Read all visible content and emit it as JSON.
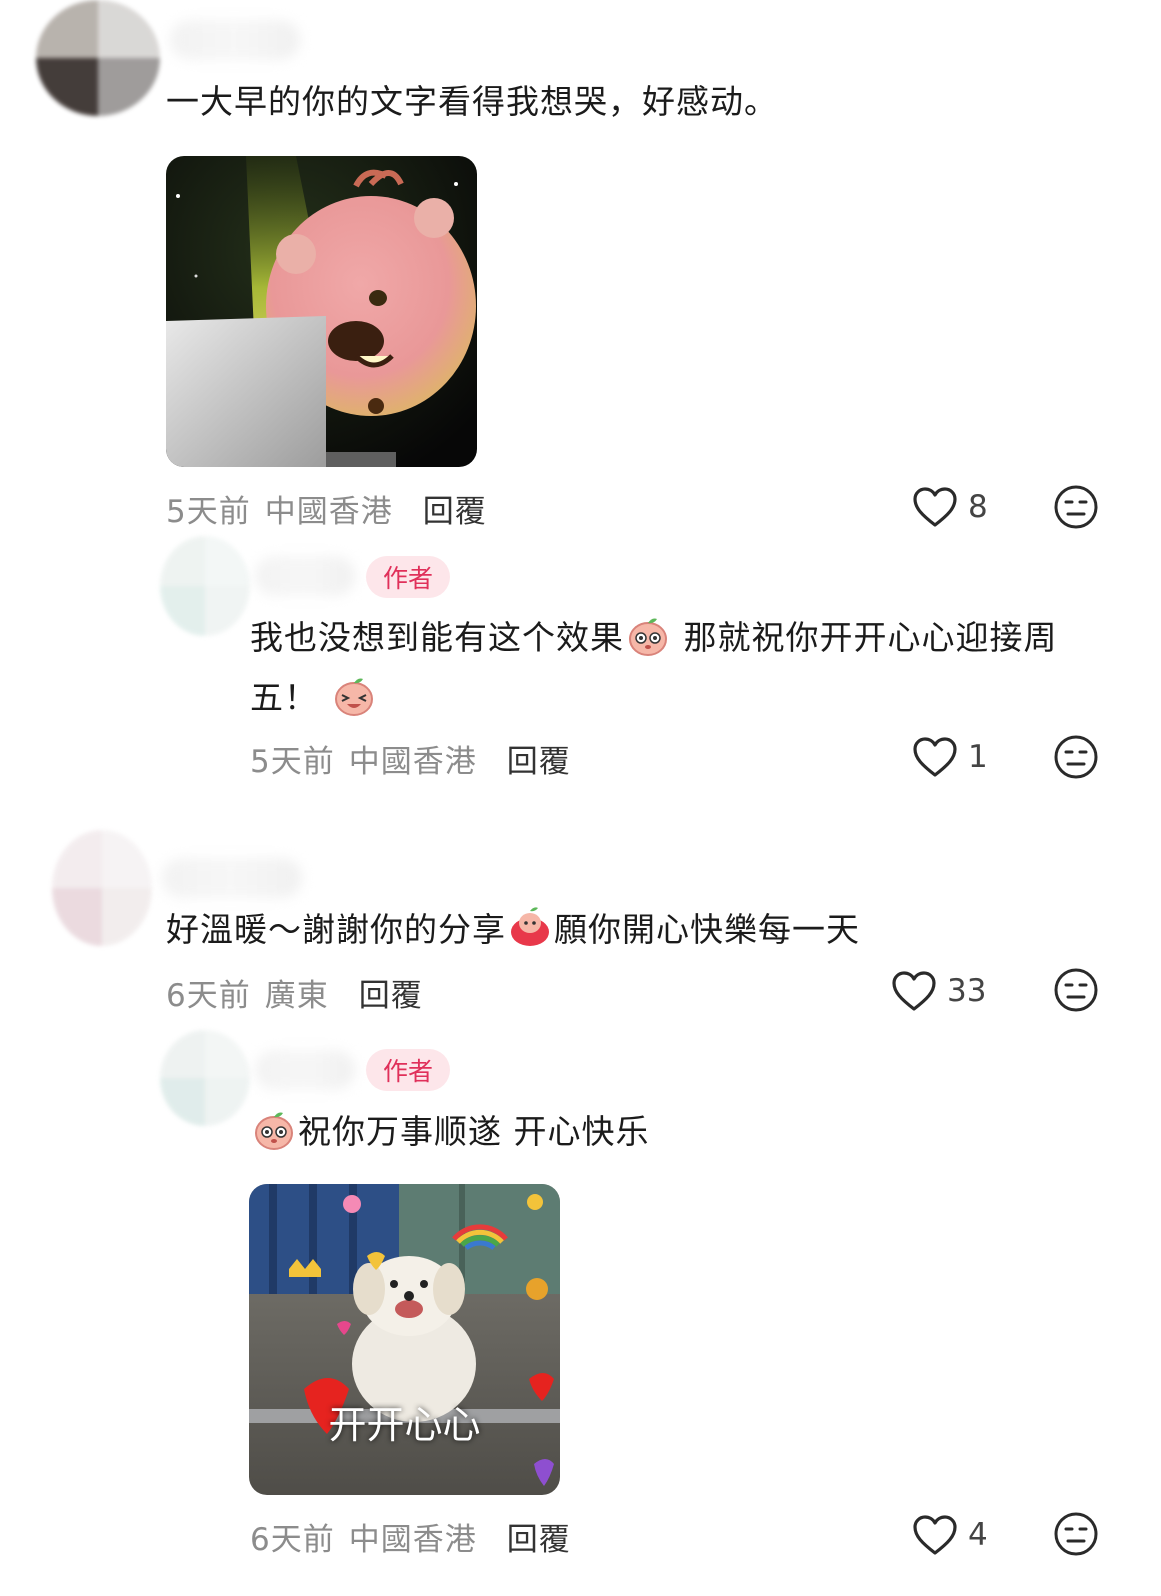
{
  "comments": [
    {
      "text": "一大早的你的文字看得我想哭，好感动。",
      "time": "5天前",
      "location": "中國香港",
      "reply_label": "回覆",
      "likes": "8",
      "sticker": "beaver-at-laptop-sticker",
      "replies": [
        {
          "badge": "作者",
          "text_part1": "我也没想到能有这个效果",
          "text_part2": "那就祝你开开心心迎接周",
          "text_part3": "五！",
          "time": "5天前",
          "location": "中國香港",
          "reply_label": "回覆",
          "likes": "1"
        }
      ]
    },
    {
      "text_part1": "好溫暖～謝謝你的分享",
      "text_part2": "願你開心快樂每一天",
      "time": "6天前",
      "location": "廣東",
      "reply_label": "回覆",
      "likes": "33",
      "replies": [
        {
          "badge": "作者",
          "text": "祝你万事顺遂 开心快乐",
          "sticker_caption": "开开心心",
          "time": "6天前",
          "location": "中國香港",
          "reply_label": "回覆",
          "likes": "4"
        }
      ]
    }
  ],
  "colors": {
    "badge_bg": "#fde6ea",
    "badge_text": "#e0305a",
    "meta": "#8c8c8c"
  },
  "icons": [
    "heart-outline-icon",
    "emoji-reaction-icon"
  ]
}
